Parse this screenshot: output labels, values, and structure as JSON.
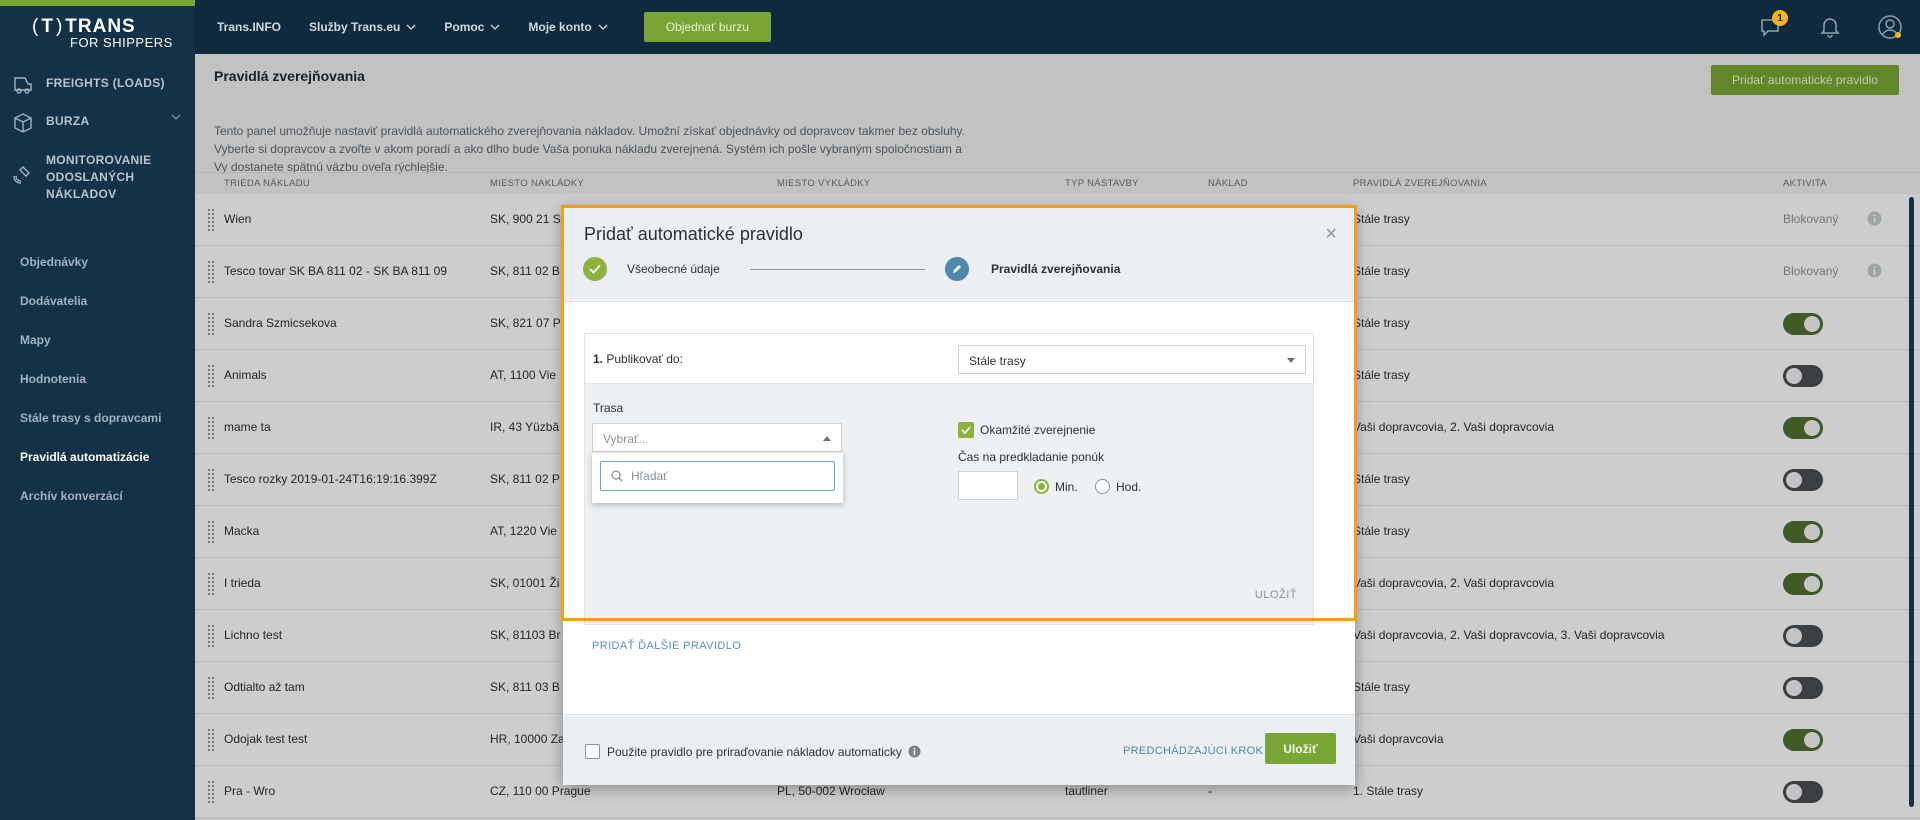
{
  "brand": {
    "l1": "TRANS",
    "l2": "FOR SHIPPERS"
  },
  "sidebar": {
    "main": [
      {
        "label": "FREIGHTS (LOADS)",
        "icon": "freight-icon"
      },
      {
        "label": "BURZA",
        "icon": "box-icon"
      },
      {
        "label": "MONITOROVANIE ODOSLANÝCH NÁKLADOV",
        "label_lines": [
          "MONITOROVANIE",
          "ODOSLANÝCH",
          "NÁKLADOV"
        ],
        "icon": "satellite-icon"
      }
    ],
    "sub": [
      "Objednávky",
      "Dodávatelia",
      "Mapy",
      "Hodnotenia",
      "Stále trasy s dopravcami",
      "Pravidlá automatizácie",
      "Archív konverzácí"
    ],
    "active_sub": "Pravidlá automatizácie"
  },
  "topnav": {
    "items": [
      "Trans.INFO",
      "Služby Trans.eu",
      "Pomoc",
      "Moje konto"
    ],
    "burza_button": "Objednať burzu",
    "notification_count": "1"
  },
  "page": {
    "title": "Pravidlá zverejňovania",
    "add_button": "Pridať automatické pravidlo",
    "description": "Tento panel umožňuje nastaviť pravidlá automatického zverejňovania nákladov. Umožní získať objednávky od dopravcov takmer bez obsluhy. Vyberte si dopravcov a zvoľte v akom poradí a ako dlho bude Vaša ponuka nákladu zverejnená. Systém ich pošle vybraným spoločnostiam a Vy dostanete spätnú väzbu oveľa rýchlejšie."
  },
  "table": {
    "headers": [
      "TRIEDA NÁKLADU",
      "MIESTO NAKLÁDKY",
      "MIESTO VYKLÁDKY",
      "TYP NÁSTAVBY",
      "NÁKLAD",
      "PRAVIDLÁ ZVEREJŇOVANIA",
      "AKTIVITA"
    ],
    "rows": [
      {
        "name": "Wien",
        "load": "SK, 900 21 S",
        "unload": "",
        "body": "",
        "cargo": "",
        "rule": "Stále trasy",
        "activity": "blocked",
        "status_text": "Blokovaný"
      },
      {
        "name": "Tesco tovar SK BA 811 02 - SK BA 811 09",
        "load": "SK, 811 02 B",
        "unload": "",
        "body": "",
        "cargo": "",
        "rule": "Stále trasy",
        "activity": "blocked",
        "status_text": "Blokovaný"
      },
      {
        "name": "Sandra Szmicsekova",
        "load": "SK, 821 07 P",
        "unload": "",
        "body": "",
        "cargo": "",
        "rule": "Stále trasy",
        "activity": "on"
      },
      {
        "name": "Animals",
        "load": "AT, 1100 Vie",
        "unload": "",
        "body": "",
        "cargo": "",
        "rule": "Stále trasy",
        "activity": "off"
      },
      {
        "name": "mame ta",
        "load": "IR, 43 Yüzbă",
        "unload": "",
        "body": "",
        "cargo": "",
        "rule": "Vaši dopravcovia, 2. Vaši dopravcovia",
        "activity": "on"
      },
      {
        "name": "Tesco rozky 2019-01-24T16:19:16.399Z",
        "load": "SK, 811 02 P",
        "unload": "",
        "body": "",
        "cargo": "",
        "rule": "Stále trasy",
        "activity": "off"
      },
      {
        "name": "Macka",
        "load": "AT, 1220 Vie",
        "unload": "",
        "body": "",
        "cargo": "",
        "rule": "Stále trasy",
        "activity": "on"
      },
      {
        "name": "I trieda",
        "load": "SK, 01001 Ži",
        "unload": "",
        "body": "",
        "cargo": "",
        "rule": "Vaši dopravcovia, 2. Vaši dopravcovia",
        "activity": "on"
      },
      {
        "name": "Lichno test",
        "load": "SK, 81103 Br",
        "unload": "",
        "body": "",
        "cargo": "",
        "rule": "Vaši dopravcovia, 2. Vaši dopravcovia, 3. Vaši dopravcovia",
        "activity": "off"
      },
      {
        "name": "Odtialto až tam",
        "load": "SK, 811 03 B",
        "unload": "",
        "body": "",
        "cargo": "",
        "rule": "Stále trasy",
        "activity": "off"
      },
      {
        "name": "Odojak test test",
        "load": "HR, 10000 Za",
        "unload": "",
        "body": "",
        "cargo": "",
        "rule": "Vaši dopravcovia",
        "activity": "on"
      },
      {
        "name": "Pra - Wro",
        "load": "CZ, 110 00 Prague",
        "unload": "PL, 50-002 Wrocław",
        "body": "tautliner",
        "cargo": "-",
        "rule": "1. Stále trasy",
        "activity": "off"
      }
    ]
  },
  "modal": {
    "title": "Pridať automatické pravidlo",
    "close": "×",
    "step1": "Všeobecné údaje",
    "step2": "Pravidlá zverejňovania",
    "rule_number": "1.",
    "publish_label": "Publikovať do:",
    "publish_value": "Stále trasy",
    "route_label": "Trasa",
    "route_placeholder": "Vybrať...",
    "search_placeholder": "Hľadať",
    "immediate_label": "Okamžité zverejnenie",
    "time_label": "Čas na predkladanie ponúk",
    "radio_min": "Min.",
    "radio_hod": "Hod.",
    "save_small": "ULOŽIŤ",
    "add_rule_link": "PRIDAŤ ĎALŠIE PRAVIDLO",
    "footer_checkbox": "Použite pravidlo pre priraďovanie nákladov automaticky",
    "prev_step": "PREDCHÁDZAJÚCI KROK",
    "save_button": "Uložiť"
  },
  "colors": {
    "accent": "#78a533",
    "sidebar": "#133147",
    "topbar": "#0f2a3d",
    "highlight": "#f39b26",
    "link": "#4f87ad"
  }
}
